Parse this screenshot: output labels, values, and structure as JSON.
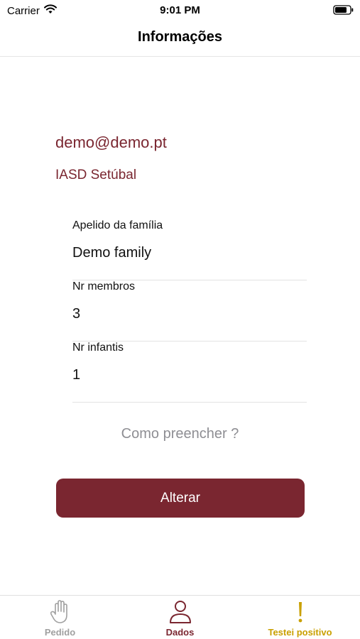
{
  "status_bar": {
    "carrier": "Carrier",
    "time": "9:01 PM",
    "wifi_icon": "wifi-icon",
    "battery_icon": "battery-icon"
  },
  "nav": {
    "title": "Informações"
  },
  "profile": {
    "email": "demo@demo.pt",
    "group": "IASD Setúbal"
  },
  "fields": [
    {
      "label": "Apelido da família",
      "value": "Demo family"
    },
    {
      "label": "Nr membros",
      "value": "3"
    },
    {
      "label": "Nr infantis",
      "value": "1"
    }
  ],
  "help_link": "Como preencher ?",
  "primary_button": "Alterar",
  "tabs": [
    {
      "label": "Pedido",
      "icon": "hand-icon",
      "color": "#a0a0a0"
    },
    {
      "label": "Dados",
      "icon": "person-icon",
      "color": "#7a2630"
    },
    {
      "label": "Testei positivo",
      "icon": "exclamation-icon",
      "color": "#c9a000"
    }
  ],
  "colors": {
    "accent": "#7a2630",
    "warning": "#c9a000",
    "inactive": "#a0a0a0"
  }
}
